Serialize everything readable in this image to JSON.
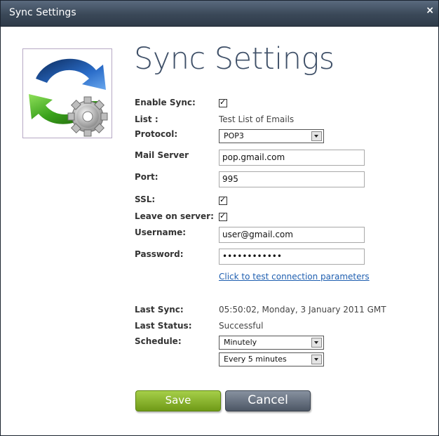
{
  "window": {
    "title": "Sync Settings",
    "close_glyph": "×"
  },
  "logo": {
    "icon": "sync-gear-icon"
  },
  "heading": "Sync Settings",
  "form": {
    "enable_sync_label": "Enable Sync:",
    "enable_sync_checked": true,
    "list_label": "List :",
    "list_value": "Test List of Emails",
    "protocol_label": "Protocol:",
    "protocol_value": "POP3",
    "mail_server_label": "Mail Server",
    "mail_server_value": "pop.gmail.com",
    "port_label": "Port:",
    "port_value": "995",
    "ssl_label": "SSL:",
    "ssl_checked": true,
    "leave_label": "Leave on server:",
    "leave_checked": true,
    "username_label": "Username:",
    "username_value": "user@gmail.com",
    "password_label": "Password:",
    "password_value": "••••••••••••",
    "test_link": "Click to test connection parameters",
    "last_sync_label": "Last Sync:",
    "last_sync_value": "05:50:02, Monday, 3 January 2011 GMT",
    "last_status_label": "Last Status:",
    "last_status_value": "Successful",
    "schedule_label": "Schedule:",
    "schedule_value": "Minutely",
    "interval_value": "Every 5 minutes"
  },
  "buttons": {
    "save": "Save",
    "cancel": "Cancel"
  },
  "colors": {
    "title_bar": "#3a4858",
    "heading": "#3f5068",
    "save": "#8cba2d",
    "cancel": "#5f6977",
    "link": "#1f5fb0"
  }
}
